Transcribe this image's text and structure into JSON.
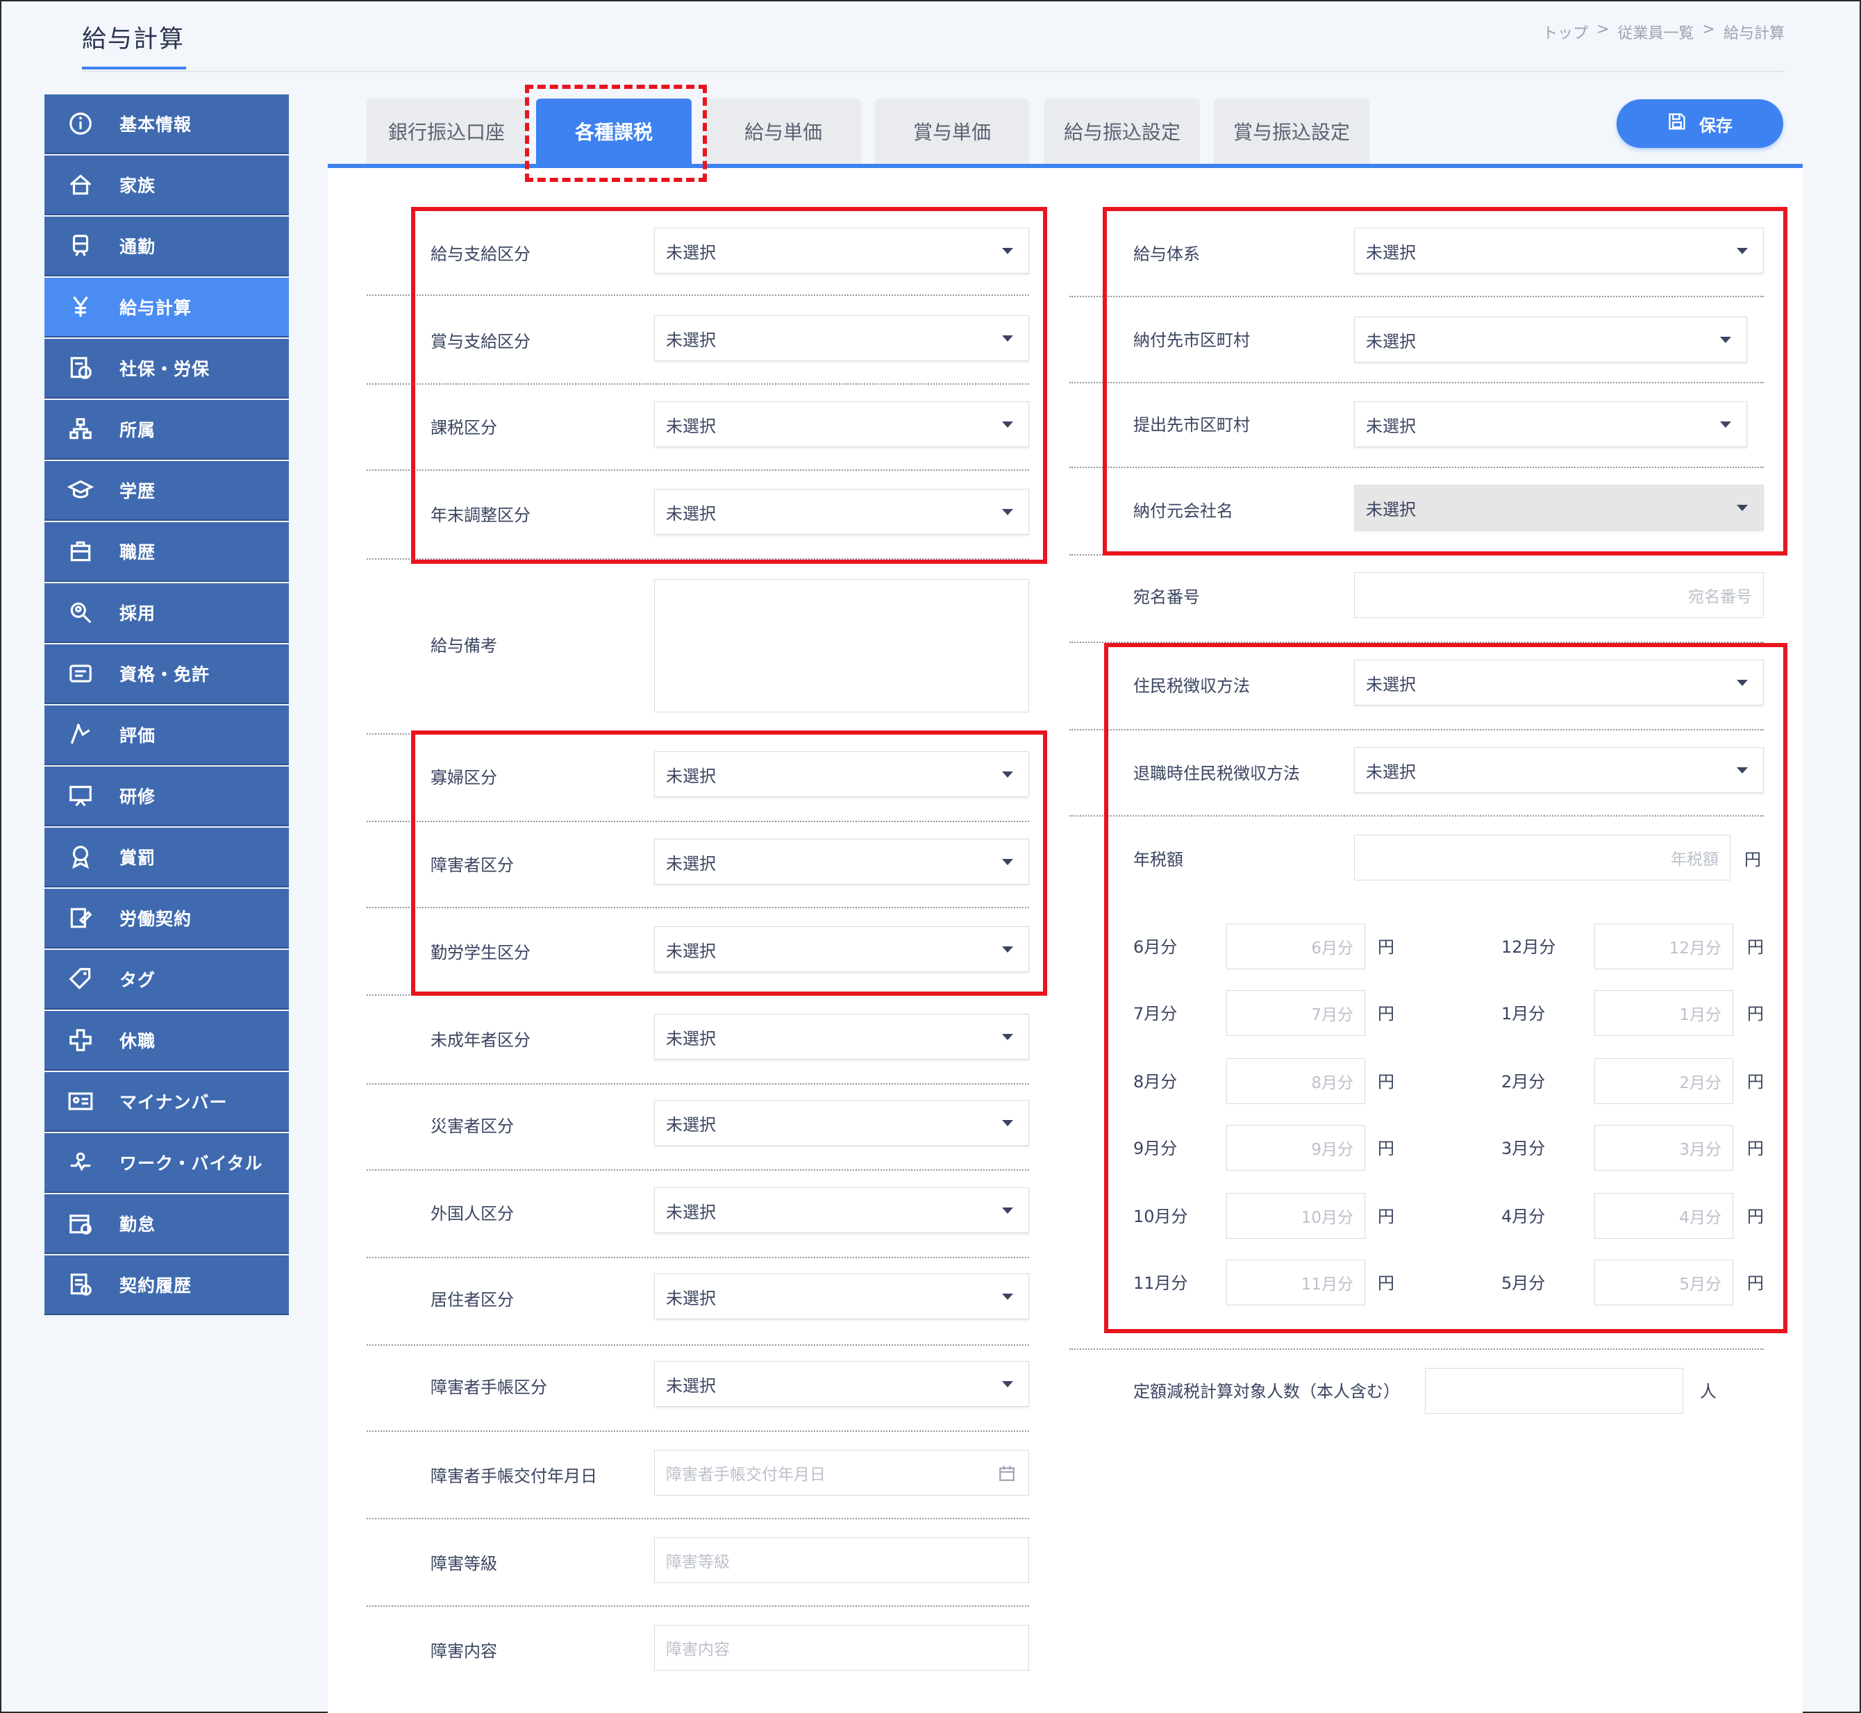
{
  "page": {
    "title": "給与計算"
  },
  "breadcrumb": [
    "トップ",
    "従業員一覧",
    "給与計算"
  ],
  "breadcrumb_sep": ">",
  "sidebar": {
    "items": [
      {
        "label": "基本情報",
        "icon": "info-icon"
      },
      {
        "label": "家族",
        "icon": "house-icon"
      },
      {
        "label": "通勤",
        "icon": "train-icon"
      },
      {
        "label": "給与計算",
        "icon": "yen-icon",
        "active": true
      },
      {
        "label": "社保・労保",
        "icon": "insurance-icon"
      },
      {
        "label": "所属",
        "icon": "org-chart-icon"
      },
      {
        "label": "学歴",
        "icon": "graduation-cap-icon"
      },
      {
        "label": "職歴",
        "icon": "briefcase-icon"
      },
      {
        "label": "採用",
        "icon": "recruit-search-icon"
      },
      {
        "label": "資格・免許",
        "icon": "license-card-icon"
      },
      {
        "label": "評価",
        "icon": "evaluation-icon"
      },
      {
        "label": "研修",
        "icon": "training-board-icon"
      },
      {
        "label": "賞罰",
        "icon": "award-icon"
      },
      {
        "label": "労働契約",
        "icon": "contract-edit-icon"
      },
      {
        "label": "タグ",
        "icon": "tag-icon"
      },
      {
        "label": "休職",
        "icon": "medical-cross-icon"
      },
      {
        "label": "マイナンバー",
        "icon": "id-card-icon"
      },
      {
        "label": "ワーク・バイタル",
        "icon": "vital-icon"
      },
      {
        "label": "勤怠",
        "icon": "calendar-clock-icon"
      },
      {
        "label": "契約履歴",
        "icon": "document-history-icon"
      }
    ]
  },
  "tabs": [
    {
      "label": "銀行振込口座"
    },
    {
      "label": "各種課税",
      "active": true
    },
    {
      "label": "給与単価"
    },
    {
      "label": "賞与単価"
    },
    {
      "label": "給与振込設定"
    },
    {
      "label": "賞与振込設定"
    }
  ],
  "save_label": "保存",
  "unselected": "未選択",
  "left_form": {
    "salary_payment_type": "給与支給区分",
    "bonus_payment_type": "賞与支給区分",
    "tax_type": "課税区分",
    "year_end_adjustment": "年末調整区分",
    "salary_note": "給与備考",
    "widow_type": "寡婦区分",
    "disabled_type": "障害者区分",
    "working_student_type": "勤労学生区分",
    "minor_type": "未成年者区分",
    "disaster_type": "災害者区分",
    "foreigner_type": "外国人区分",
    "resident_type": "居住者区分",
    "disability_handbook_type": "障害者手帳区分",
    "handbook_issue_date": "障害者手帳交付年月日",
    "handbook_issue_date_placeholder": "障害者手帳交付年月日",
    "disability_grade": "障害等級",
    "disability_grade_placeholder": "障害等級",
    "disability_content": "障害内容",
    "disability_content_placeholder": "障害内容"
  },
  "right_form": {
    "salary_system": "給与体系",
    "payment_municipality": "納付先市区町村",
    "submission_municipality": "提出先市区町村",
    "payer_company": "納付元会社名",
    "address_number": "宛名番号",
    "address_number_placeholder": "宛名番号",
    "resident_tax_method": "住民税徴収方法",
    "retirement_tax_method": "退職時住民税徴収方法",
    "annual_tax": "年税額",
    "annual_tax_placeholder": "年税額",
    "yen": "円",
    "months_left": [
      "6月分",
      "7月分",
      "8月分",
      "9月分",
      "10月分",
      "11月分"
    ],
    "months_right": [
      "12月分",
      "1月分",
      "2月分",
      "3月分",
      "4月分",
      "5月分"
    ],
    "fixed_reduction_label": "定額減税計算対象人数（本人含む）",
    "person_unit": "人"
  },
  "colors": {
    "accent": "#3d82f0",
    "sidebar": "#3f6ab0",
    "highlight": "#e8141e"
  }
}
